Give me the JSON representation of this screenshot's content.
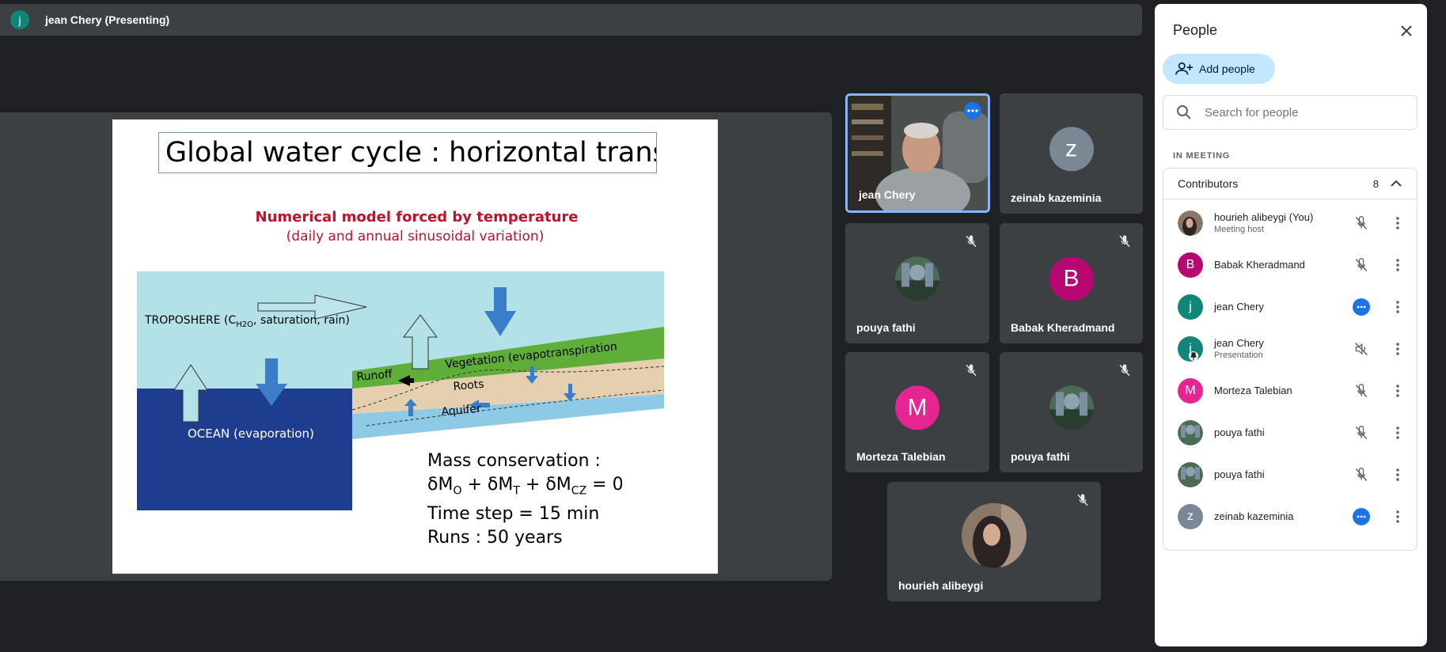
{
  "presenter": {
    "initial": "j",
    "label": "jean Chery (Presenting)"
  },
  "slide": {
    "title": "Global water cycle : horizontal transfer",
    "subtitle_line1": "Numerical model forced by temperature",
    "subtitle_line2": "(daily and annual sinusoidal variation)",
    "troposphere_pre": "TROPOSHERE (C",
    "troposphere_sub": "H2O",
    "troposphere_post": ", saturation, rain)",
    "ocean_label": "OCEAN (evaporation)",
    "runoff_label": "Runoff",
    "vegetation_label": "Vegetation (evapotranspiration",
    "roots_label": "Roots",
    "aquifer_label": "Aquifer",
    "mass_line1": "Mass conservation :",
    "mass_line2_parts": [
      "δM",
      "O",
      " + δM",
      "T",
      " + δM",
      "CZ",
      " = 0"
    ],
    "mass_line3": "Time step = 15 min",
    "mass_line4": "Runs : 50 years"
  },
  "tiles": [
    {
      "name": "jean Chery"
    },
    {
      "name": "zeinab kazeminia",
      "initial": "z"
    },
    {
      "name": "pouya fathi"
    },
    {
      "name": "Babak Kheradmand",
      "initial": "B"
    },
    {
      "name": "Morteza Talebian",
      "initial": "M"
    },
    {
      "name": "pouya fathi"
    },
    {
      "name": "hourieh alibeygi"
    }
  ],
  "panel": {
    "title": "People",
    "add_label": "Add people",
    "search_placeholder": "Search for people",
    "in_meeting_label": "IN MEETING",
    "contributors_label": "Contributors",
    "contributors_count": "8",
    "participants": [
      {
        "name": "hourieh alibeygi (You)",
        "sub": "Meeting host"
      },
      {
        "name": "Babak Kheradmand",
        "initial": "B"
      },
      {
        "name": "jean Chery",
        "initial": "j"
      },
      {
        "name": "jean Chery",
        "initial": "j",
        "sub": "Presentation"
      },
      {
        "name": "Morteza Talebian",
        "initial": "M"
      },
      {
        "name": "pouya fathi"
      },
      {
        "name": "pouya fathi"
      },
      {
        "name": "zeinab kazeminia",
        "initial": "z"
      }
    ]
  },
  "colors": {
    "accent_blue": "#1a73e8",
    "teal": "#12857a",
    "magenta": "#b80672",
    "pink": "#e52592",
    "grey_avatar": "#7b8794",
    "ocean": "#1f3d8e",
    "sky": "#b3e1e8",
    "vegetation": "#5fae3a"
  }
}
